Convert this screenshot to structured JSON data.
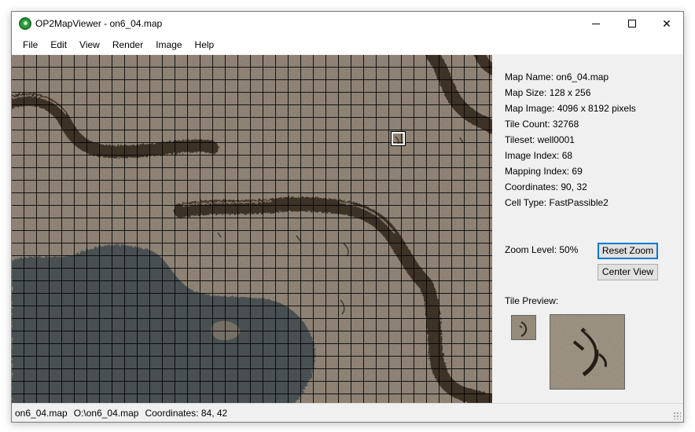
{
  "window": {
    "title": "OP2MapViewer - on6_04.map",
    "icon": "app-globe-icon"
  },
  "menu": [
    "File",
    "Edit",
    "View",
    "Render",
    "Image",
    "Help"
  ],
  "info": {
    "map_name": "Map Name: on6_04.map",
    "map_size": "Map Size: 128 x 256",
    "map_image": "Map Image: 4096 x 8192 pixels",
    "tile_count": "Tile Count: 32768",
    "tileset": "Tileset: well0001",
    "image_index": "Image Index: 68",
    "mapping_index": "Mapping Index: 69",
    "coordinates": "Coordinates: 90, 32",
    "cell_type": "Cell Type: FastPassible2"
  },
  "zoom": {
    "label": "Zoom Level: 50%",
    "reset_button": "Reset Zoom",
    "center_button": "Center View"
  },
  "tile_preview": {
    "label": "Tile Preview:"
  },
  "status": {
    "file": "on6_04.map",
    "path": "O:\\on6_04.map",
    "coords": "Coordinates: 84, 42"
  },
  "colors": {
    "terrain": "#84786a",
    "ridge": "#3e3327",
    "water": "#434c50",
    "selection": "#ffffff",
    "focus": "#0078d7"
  }
}
